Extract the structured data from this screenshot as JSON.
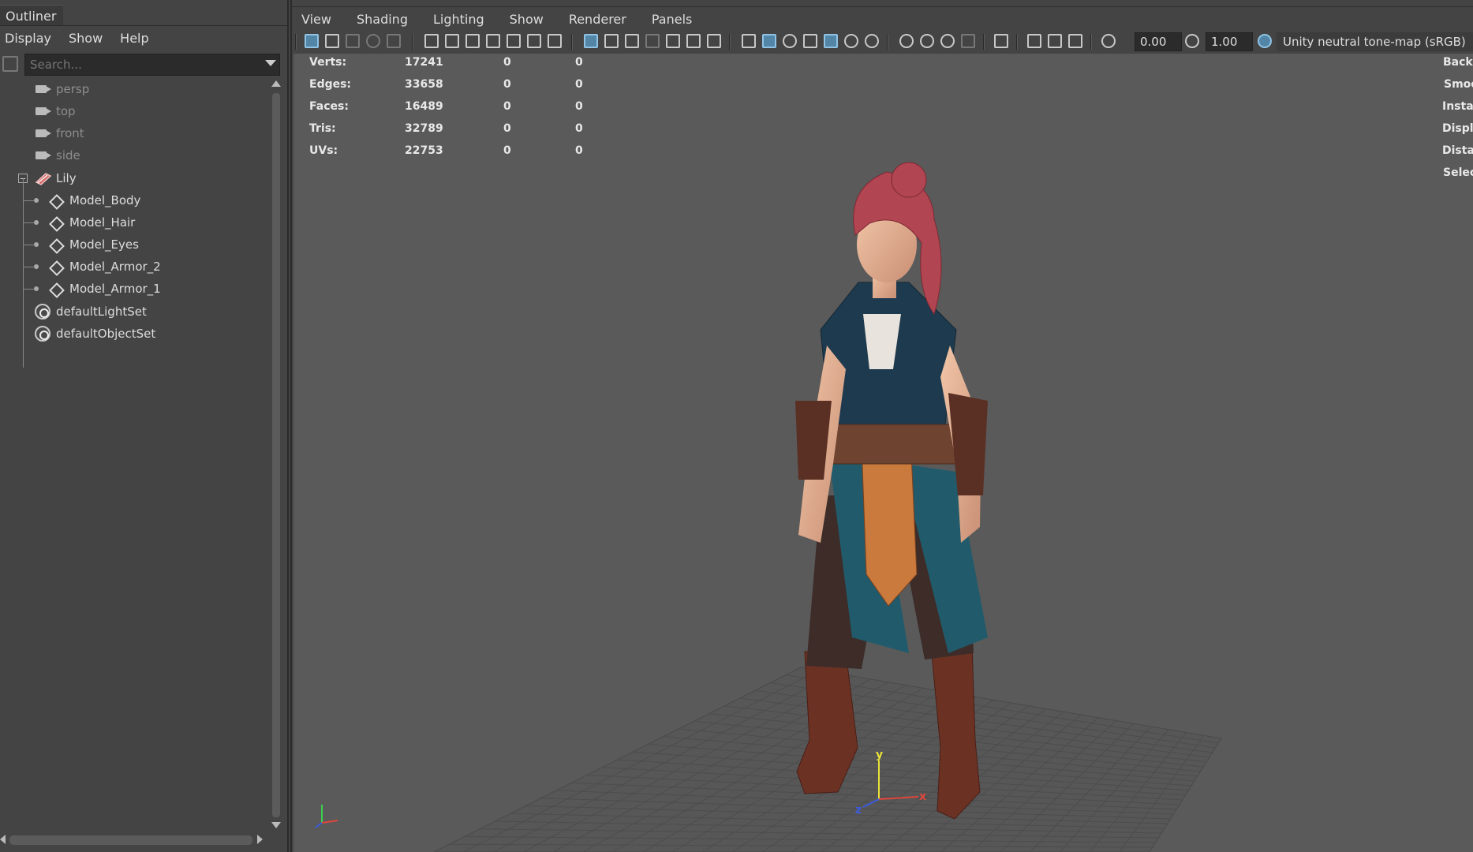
{
  "outliner": {
    "tab_title": "Outliner",
    "menu": [
      "Display",
      "Show",
      "Help"
    ],
    "search_placeholder": "Search...",
    "items": [
      {
        "label": "persp",
        "icon": "camera-icon"
      },
      {
        "label": "top",
        "icon": "camera-icon"
      },
      {
        "label": "front",
        "icon": "camera-icon"
      },
      {
        "label": "side",
        "icon": "camera-icon"
      },
      {
        "label": "Lily",
        "icon": "group-transform-icon"
      },
      {
        "label": "Model_Body",
        "icon": "mesh-transform-icon"
      },
      {
        "label": "Model_Hair",
        "icon": "mesh-transform-icon"
      },
      {
        "label": "Model_Eyes",
        "icon": "mesh-transform-icon"
      },
      {
        "label": "Model_Armor_2",
        "icon": "mesh-transform-icon"
      },
      {
        "label": "Model_Armor_1",
        "icon": "mesh-transform-icon"
      },
      {
        "label": "defaultLightSet",
        "icon": "set-icon"
      },
      {
        "label": "defaultObjectSet",
        "icon": "set-icon"
      }
    ]
  },
  "viewport": {
    "menu": [
      "View",
      "Shading",
      "Lighting",
      "Show",
      "Renderer",
      "Panels"
    ],
    "toolbar": {
      "exposure_value": "0.00",
      "gamma_value": "1.00",
      "color_transform": "Unity neutral tone-map (sRGB)"
    },
    "hud_stats": [
      {
        "label": "Verts:",
        "v1": "17241",
        "v2": "0",
        "v3": "0"
      },
      {
        "label": "Edges:",
        "v1": "33658",
        "v2": "0",
        "v3": "0"
      },
      {
        "label": "Faces:",
        "v1": "16489",
        "v2": "0",
        "v3": "0"
      },
      {
        "label": "Tris:",
        "v1": "32789",
        "v2": "0",
        "v3": "0"
      },
      {
        "label": "UVs:",
        "v1": "22753",
        "v2": "0",
        "v3": "0"
      }
    ],
    "hud_right": [
      "Backf",
      "Smoo",
      "Instar",
      "Displa",
      "Distar",
      "Selec"
    ],
    "axis_labels": {
      "y": "y",
      "x": "x",
      "z": "z"
    },
    "colors": {
      "accent": "#5285a6",
      "x_axis": "#e0463c",
      "y_axis": "#e8e23a",
      "z_axis": "#3b5ce0"
    }
  }
}
